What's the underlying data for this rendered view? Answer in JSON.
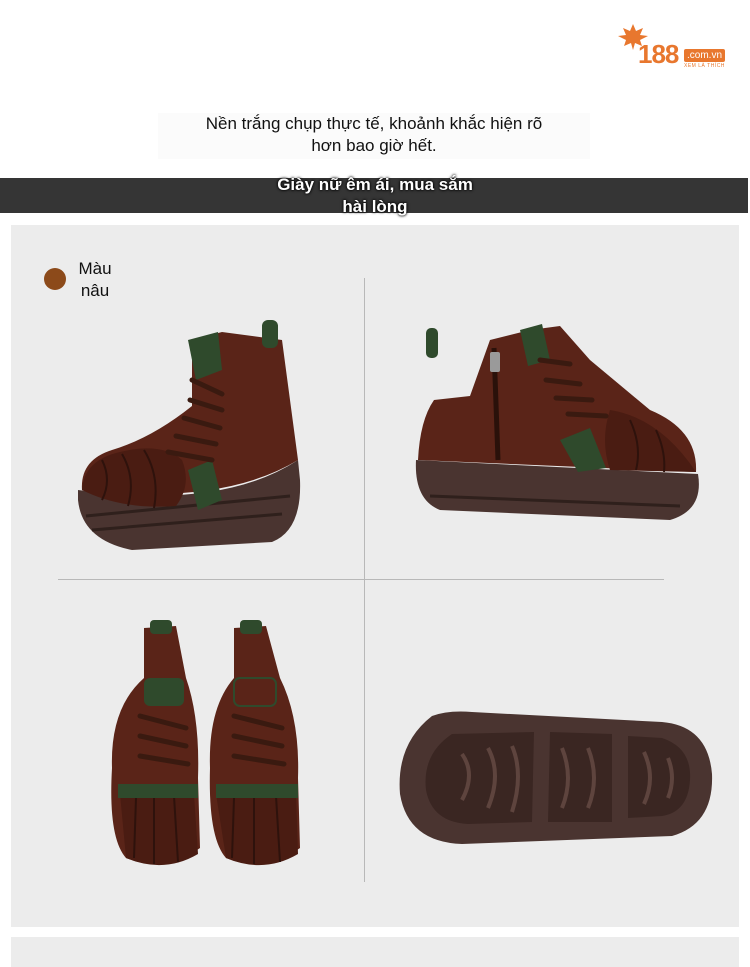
{
  "header": {
    "logo": {
      "number": "188",
      "domain": ".com.vn",
      "tagline": "XEM LÀ THÍCH"
    }
  },
  "intro": {
    "line1": "Nền trắng chụp thực tế, khoảnh khắc hiện rõ",
    "line2": "hơn bao giờ hết."
  },
  "banner": {
    "line1": "Giày nữ êm ái, mua sắm",
    "line2": "hài lòng"
  },
  "color_option": {
    "label_line1": "Màu",
    "label_line2": "nâu",
    "swatch_color": "#8c4a1a"
  },
  "colors": {
    "accent": "#e8772e",
    "leather": "#5a2418",
    "sole": "#4a3430",
    "trim_green": "#2f4a2c"
  }
}
